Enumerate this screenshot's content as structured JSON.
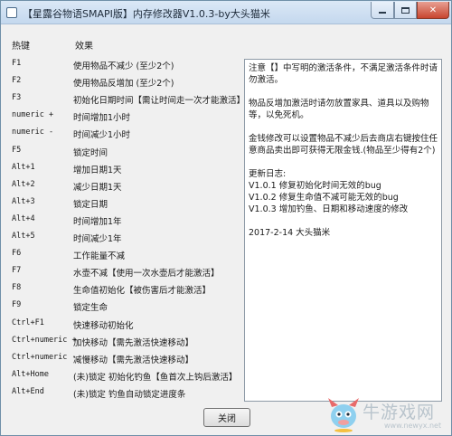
{
  "window": {
    "title": "【星露谷物语SMAPI版】内存修改器V1.0.3-by大头猫米",
    "minimize_label": "_",
    "maximize_label": "□",
    "close_label": "✕"
  },
  "table": {
    "header_key": "热键",
    "header_effect": "效果",
    "rows": [
      {
        "key": "F1",
        "effect": "使用物品不减少 (至少2个)"
      },
      {
        "key": "F2",
        "effect": "使用物品反增加 (至少2个)"
      },
      {
        "key": "F3",
        "effect": "初始化日期时间【需让时间走一次才能激活】"
      },
      {
        "key": "numeric +",
        "effect": "时间增加1小时"
      },
      {
        "key": "numeric -",
        "effect": "时间减少1小时"
      },
      {
        "key": "F5",
        "effect": "锁定时间"
      },
      {
        "key": "Alt+1",
        "effect": "增加日期1天"
      },
      {
        "key": "Alt+2",
        "effect": "减少日期1天"
      },
      {
        "key": "Alt+3",
        "effect": "锁定日期"
      },
      {
        "key": "Alt+4",
        "effect": "时间增加1年"
      },
      {
        "key": "Alt+5",
        "effect": "时间减少1年"
      },
      {
        "key": "F6",
        "effect": "工作能量不减"
      },
      {
        "key": "F7",
        "effect": "水壶不减【使用一次水壶后才能激活】"
      },
      {
        "key": "F8",
        "effect": "生命值初始化【被伤害后才能激活】"
      },
      {
        "key": "F9",
        "effect": "锁定生命"
      },
      {
        "key": "Ctrl+F1",
        "effect": "快速移动初始化"
      },
      {
        "key": "Ctrl+numeric +",
        "effect": "加快移动【需先激活快速移动】"
      },
      {
        "key": "Ctrl+numeric -",
        "effect": "减慢移动【需先激活快速移动】"
      },
      {
        "key": "Alt+Home",
        "effect": "(未)锁定 初始化钓鱼【鱼首次上钩后激活】"
      },
      {
        "key": "Alt+End",
        "effect": "(未)锁定 钓鱼自动锁定进度条"
      }
    ]
  },
  "notes": {
    "note1": "注意【】中写明的激活条件，不满足激活条件时请勿激活。",
    "note2": "物品反增加激活时请勿放置家具、道具以及购物等，以免死机。",
    "note3": "金钱修改可以设置物品不减少后去商店右键按住任意商品卖出即可获得无限金钱.(物品至少得有2个)",
    "log_title": "更新日志:",
    "log1": "V1.0.1 修复初始化时间无效的bug",
    "log2": "V1.0.2 修复生命值不减可能无效的bug",
    "log3": "V1.0.3 增加钓鱼、日期和移动速度的修改",
    "signature": "2017-2-14 大头猫米"
  },
  "footer": {
    "close_button": "关闭"
  },
  "watermark": {
    "title": "牛游戏网",
    "url": "www.newyx.net"
  }
}
